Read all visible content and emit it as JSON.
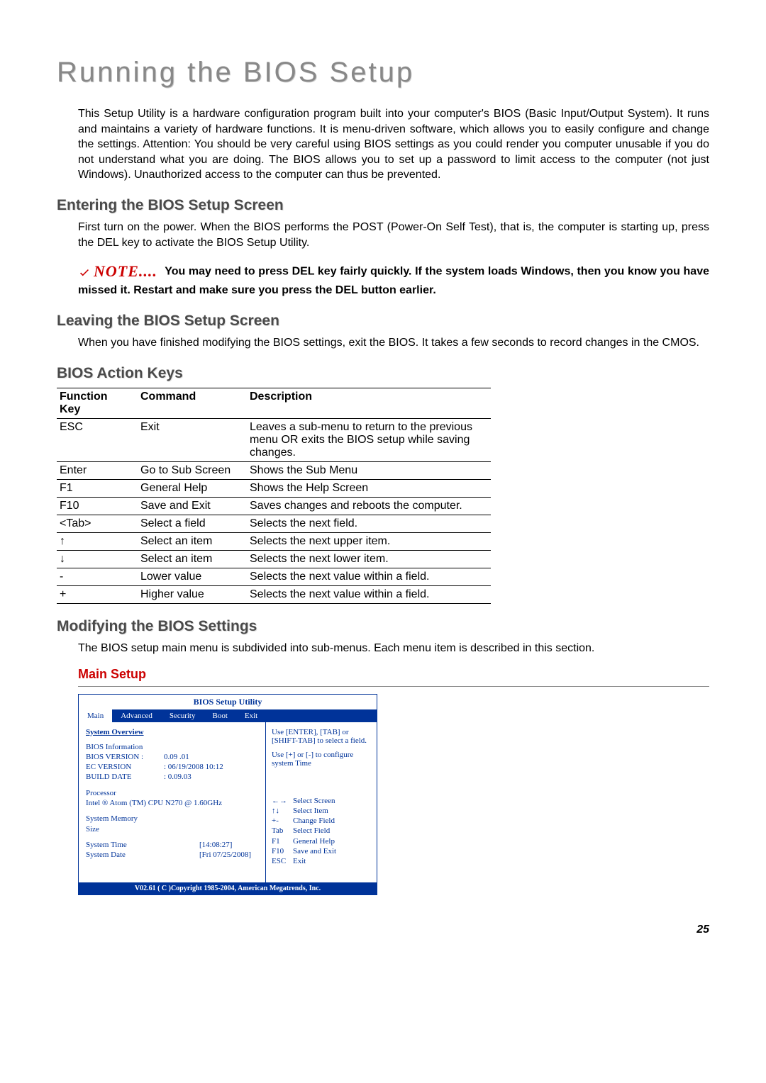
{
  "page_number": "25",
  "title": "Running the BIOS Setup",
  "intro": "This Setup Utility is a hardware configuration program built into your computer's BIOS (Basic Input/Output System). It runs and maintains a variety of hardware functions. It is menu-driven software, which allows you to easily configure and change the settings. Attention: You should be very careful using BIOS settings as you could render you computer unusable if you do not understand what you are doing. The BIOS allows you to set up a password to limit access to the computer (not just Windows). Unauthorized access to the computer can thus be prevented.",
  "entering": {
    "heading": "Entering the BIOS Setup Screen",
    "body": "First turn on the power. When the BIOS performs the POST (Power-On Self Test), that is, the computer is starting up, press the DEL key to activate the BIOS Setup Utility."
  },
  "note": {
    "label": "NOTE....",
    "text": "You may need to press DEL key fairly quickly. If the system loads Windows, then you know you have missed it.  Restart and make sure you press the DEL button earlier."
  },
  "leaving": {
    "heading": "Leaving the BIOS Setup Screen",
    "body": "When you have finished modifying the BIOS settings, exit the BIOS. It takes a few seconds to record changes in the CMOS."
  },
  "action_keys": {
    "heading": "BIOS Action Keys",
    "columns": [
      "Function Key",
      "Command",
      "Description"
    ],
    "rows": [
      [
        "ESC",
        "Exit",
        "Leaves a sub-menu to return to the previous menu OR exits the BIOS setup while saving changes."
      ],
      [
        "Enter",
        "Go to Sub Screen",
        "Shows the Sub Menu"
      ],
      [
        "F1",
        "General Help",
        "Shows the Help Screen"
      ],
      [
        "F10",
        "Save and Exit",
        "Saves changes and reboots the computer."
      ],
      [
        "<Tab>",
        "Select a field",
        "Selects the next field."
      ],
      [
        "↑",
        "Select an item",
        "Selects the next upper item."
      ],
      [
        "↓",
        "Select an item",
        "Selects the next lower item."
      ],
      [
        "-",
        "Lower value",
        "Selects the next value within a field."
      ],
      [
        "+",
        "Higher value",
        "Selects the next value within a field."
      ]
    ]
  },
  "modifying": {
    "heading": "Modifying the BIOS Settings",
    "body": "The BIOS setup main menu is subdivided into sub-menus.  Each menu item is described in this section.",
    "sub": "Main Setup"
  },
  "bios": {
    "title": "BIOS Setup Utility",
    "tabs": [
      "Main",
      "Advanced",
      "Security",
      "Boot",
      "Exit"
    ],
    "active_tab": "Main",
    "overview_heading": "System Overview",
    "info_label": "BIOS Information",
    "bios_version_label": "BIOS VERSION :",
    "bios_version_value": "0.09   .01",
    "ec_version_label": "EC VERSION",
    "ec_version_value": ": 06/19/2008   10:12",
    "build_date_label": "BUILD DATE",
    "build_date_value": ": 0.09.03",
    "processor_label": "Processor",
    "processor_value": "Intel ® Atom (TM) CPU N270   @    1.60GHz",
    "memory_label": "System Memory",
    "memory_sub": "Size",
    "system_time_label": "System Time",
    "system_time_value": "[14:08:27]",
    "system_date_label": "System Date",
    "system_date_value": "[Fri 07/25/2008]",
    "help_text1": "Use [ENTER], [TAB] or [SHIFT-TAB] to select a field.",
    "help_text2": "Use [+] or [-] to configure system Time",
    "help_keys": [
      [
        "←→",
        "Select Screen"
      ],
      [
        "↑↓",
        "Select Item"
      ],
      [
        "+-",
        "Change Field"
      ],
      [
        "Tab",
        "Select Field"
      ],
      [
        "F1",
        "General Help"
      ],
      [
        "F10",
        "Save and Exit"
      ],
      [
        "ESC",
        "Exit"
      ]
    ],
    "copyright": "V02.61 ( C )Copyright 1985-2004, American Megatrends, Inc."
  }
}
